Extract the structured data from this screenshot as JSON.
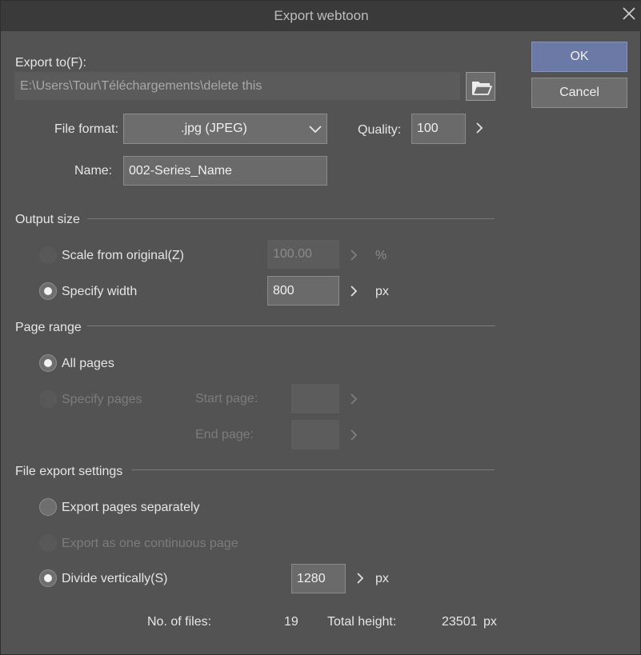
{
  "window": {
    "title": "Export webtoon"
  },
  "export_to": {
    "label": "Export to(F):",
    "path": "E:\\Users\\Tour\\Téléchargements\\delete this"
  },
  "file_format": {
    "label": "File format:",
    "value": ".jpg (JPEG)"
  },
  "quality": {
    "label": "Quality:",
    "value": "100"
  },
  "name": {
    "label": "Name:",
    "value": "002-Series_Name"
  },
  "buttons": {
    "ok": "OK",
    "cancel": "Cancel"
  },
  "output_size": {
    "heading": "Output size",
    "scale_label": "Scale from original(Z)",
    "scale_value": "100.00",
    "scale_unit": "%",
    "width_label": "Specify width",
    "width_value": "800",
    "width_unit": "px",
    "selected": "Specify width"
  },
  "page_range": {
    "heading": "Page range",
    "all_label": "All pages",
    "specify_label": "Specify pages",
    "start_label": "Start page:",
    "end_label": "End page:",
    "start_value": "",
    "end_value": "",
    "selected": "All pages"
  },
  "file_export": {
    "heading": "File export settings",
    "separate_label": "Export pages separately",
    "continuous_label": "Export as one continuous page",
    "divide_label": "Divide vertically(S)",
    "divide_value": "1280",
    "divide_unit": "px",
    "selected": "Divide vertically(S)"
  },
  "summary": {
    "files_label": "No. of files:",
    "files_value": "19",
    "height_label": "Total height:",
    "height_value": "23501",
    "height_unit": "px"
  },
  "icons": [
    "close-icon",
    "folder-open-icon",
    "chevron-down-icon",
    "chevron-right-icon"
  ],
  "colors": {
    "accent": "#6a79a6",
    "background": "#535353",
    "titlebar": "#3a3a3a"
  }
}
